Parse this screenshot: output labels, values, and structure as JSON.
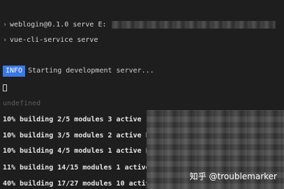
{
  "terminal": {
    "chevron": "›",
    "line1": "weblogin@0.1.0 serve E:",
    "line2": "vue-cli-service serve",
    "info_badge": "INFO",
    "info_text": "Starting development server...",
    "cursor": "",
    "undefined_text": "undefined",
    "build_lines": [
      "10% building 2/5 modules 3 active",
      "10% building 3/5 modules 2 active E.",
      "10% building 4/5 modules 1 active E.",
      "11% building 14/15 modules 1 active E.",
      "40% building 17/27 modules 10 active ..."
    ]
  },
  "watermark": "知乎 @troublemarker"
}
